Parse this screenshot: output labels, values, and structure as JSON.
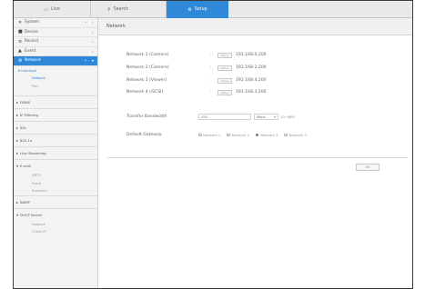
{
  "topbar": {
    "tabs": [
      {
        "label": "Live",
        "icon": "monitor-icon"
      },
      {
        "label": "Search",
        "icon": "search-icon"
      },
      {
        "label": "Setup",
        "icon": "gear-icon"
      }
    ]
  },
  "sidebar": {
    "main_items": [
      {
        "label": "System",
        "icon": "x-tools-icon"
      },
      {
        "label": "Device",
        "icon": "camera-icon"
      },
      {
        "label": "Record",
        "icon": "record-icon"
      },
      {
        "label": "Event",
        "icon": "event-icon"
      },
      {
        "label": "Network",
        "icon": "gear-icon"
      }
    ],
    "interface": {
      "label": "Interface",
      "children": [
        "Network",
        "Port"
      ]
    },
    "sections": [
      {
        "label": "DDNS"
      },
      {
        "label": "IP Filtering"
      },
      {
        "label": "SSL"
      },
      {
        "label": "802.1x"
      },
      {
        "label": "Live Streaming"
      },
      {
        "label": "E-mail",
        "children": [
          "SMTP",
          "Event",
          "Recipient"
        ]
      },
      {
        "label": "SNMP"
      },
      {
        "label": "DHCP Server",
        "children": [
          "Network",
          "Check IP"
        ]
      }
    ]
  },
  "content": {
    "title": "Network",
    "networks": [
      {
        "label": "Network 1 (Camera)",
        "button": "Setup",
        "ip": "192.168.0.200"
      },
      {
        "label": "Network 2 (Camera)",
        "button": "Setup",
        "ip": "192.168.2.200"
      },
      {
        "label": "Network 3 (Viewer)",
        "button": "Setup",
        "ip": "192.168.4.200"
      },
      {
        "label": "Network 4 (iSCSI)",
        "button": "Setup",
        "ip": "192.168.3.200"
      }
    ],
    "transfer_bandwidth": {
      "label": "Transfer Bandwidth",
      "value": "450",
      "unit": "Mbps",
      "range": "(0~400)"
    },
    "default_gateway": {
      "label": "Default Gateway",
      "options": [
        "Network 1",
        "Network 2",
        "Network 3",
        "Network 4"
      ],
      "selected_index": 2
    },
    "ok_label": "OK"
  },
  "colors": {
    "accent": "#2f88d8",
    "frame": "#3a3a3a"
  }
}
